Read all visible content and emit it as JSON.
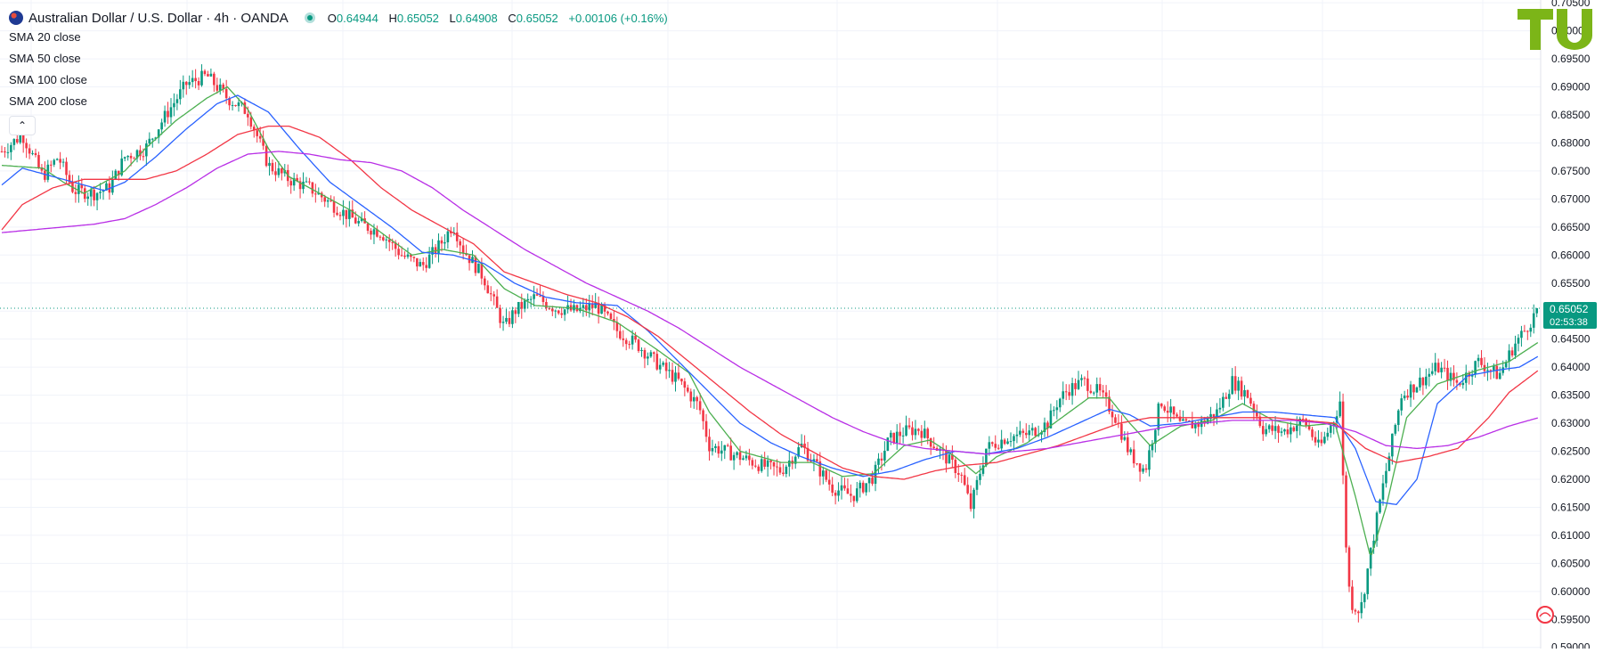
{
  "header": {
    "symbol_title": "Australian Dollar / U.S. Dollar · 4h · OANDA",
    "ohlc": {
      "open_label": "O",
      "open": "0.64944",
      "high_label": "H",
      "high": "0.65052",
      "low_label": "L",
      "low": "0.64908",
      "close_label": "C",
      "close": "0.65052",
      "change": "+0.00106 (+0.16%)"
    },
    "indicators": [
      {
        "name": "SMA",
        "param": "20 close"
      },
      {
        "name": "SMA",
        "param": "50 close"
      },
      {
        "name": "SMA",
        "param": "100 close"
      },
      {
        "name": "SMA",
        "param": "200 close"
      }
    ],
    "collapse_symbol": "⌃"
  },
  "price_badge": {
    "price": "0.65052",
    "countdown": "02:53:38"
  },
  "colors": {
    "up": "#089981",
    "down": "#f23645",
    "sma20": "#4caf50",
    "sma50": "#2962ff",
    "sma100": "#f23645",
    "sma200": "#b92fe6",
    "grid": "#f0f3fa",
    "axis_text": "#131722",
    "logo": "#7cb518"
  },
  "chart_data": {
    "type": "line",
    "title": "",
    "xlabel": "",
    "ylabel": "",
    "ylim": [
      0.5898,
      0.7055
    ],
    "y_ticks": [
      "0.59000",
      "0.59500",
      "0.60000",
      "0.60500",
      "0.61000",
      "0.61500",
      "0.62000",
      "0.62500",
      "0.63000",
      "0.63500",
      "0.64000",
      "0.64500",
      "0.65000",
      "0.65500",
      "0.66000",
      "0.66500",
      "0.67000",
      "0.67500",
      "0.68000",
      "0.68500",
      "0.69000",
      "0.69500",
      "0.70000",
      "0.70500"
    ],
    "grid": true,
    "last_price": 0.65052,
    "price_anchors": [
      [
        0,
        0.6785
      ],
      [
        20,
        0.6815
      ],
      [
        40,
        0.674
      ],
      [
        55,
        0.6775
      ],
      [
        70,
        0.6715
      ],
      [
        90,
        0.671
      ],
      [
        105,
        0.672
      ],
      [
        120,
        0.6775
      ],
      [
        140,
        0.679
      ],
      [
        160,
        0.685
      ],
      [
        180,
        0.6905
      ],
      [
        200,
        0.692
      ],
      [
        220,
        0.688
      ],
      [
        240,
        0.6855
      ],
      [
        260,
        0.676
      ],
      [
        280,
        0.6735
      ],
      [
        300,
        0.672
      ],
      [
        330,
        0.668
      ],
      [
        350,
        0.6655
      ],
      [
        370,
        0.664
      ],
      [
        390,
        0.66
      ],
      [
        410,
        0.658
      ],
      [
        430,
        0.6625
      ],
      [
        440,
        0.6655
      ],
      [
        450,
        0.661
      ],
      [
        470,
        0.656
      ],
      [
        490,
        0.647
      ],
      [
        500,
        0.65
      ],
      [
        520,
        0.6525
      ],
      [
        540,
        0.6505
      ],
      [
        560,
        0.65
      ],
      [
        580,
        0.651
      ],
      [
        600,
        0.6465
      ],
      [
        620,
        0.644
      ],
      [
        640,
        0.6405
      ],
      [
        660,
        0.6375
      ],
      [
        680,
        0.633
      ],
      [
        690,
        0.626
      ],
      [
        720,
        0.624
      ],
      [
        740,
        0.6225
      ],
      [
        760,
        0.6215
      ],
      [
        780,
        0.626
      ],
      [
        790,
        0.6235
      ],
      [
        810,
        0.6185
      ],
      [
        830,
        0.617
      ],
      [
        850,
        0.6205
      ],
      [
        865,
        0.627
      ],
      [
        880,
        0.6285
      ],
      [
        895,
        0.629
      ],
      [
        910,
        0.626
      ],
      [
        925,
        0.623
      ],
      [
        935,
        0.621
      ],
      [
        945,
        0.615
      ],
      [
        960,
        0.6255
      ],
      [
        980,
        0.6275
      ],
      [
        1000,
        0.628
      ],
      [
        1020,
        0.63
      ],
      [
        1030,
        0.634
      ],
      [
        1040,
        0.636
      ],
      [
        1055,
        0.6375
      ],
      [
        1070,
        0.6355
      ],
      [
        1085,
        0.6315
      ],
      [
        1100,
        0.6245
      ],
      [
        1115,
        0.6215
      ],
      [
        1130,
        0.634
      ],
      [
        1150,
        0.6295
      ],
      [
        1170,
        0.63
      ],
      [
        1185,
        0.632
      ],
      [
        1200,
        0.6375
      ],
      [
        1215,
        0.635
      ],
      [
        1230,
        0.629
      ],
      [
        1250,
        0.6285
      ],
      [
        1270,
        0.6305
      ],
      [
        1285,
        0.6255
      ],
      [
        1300,
        0.631
      ],
      [
        1305,
        0.634
      ],
      [
        1310,
        0.611
      ],
      [
        1315,
        0.598
      ],
      [
        1325,
        0.5965
      ],
      [
        1335,
        0.607
      ],
      [
        1345,
        0.617
      ],
      [
        1355,
        0.626
      ],
      [
        1365,
        0.635
      ],
      [
        1380,
        0.637
      ],
      [
        1400,
        0.64
      ],
      [
        1420,
        0.637
      ],
      [
        1440,
        0.641
      ],
      [
        1460,
        0.6385
      ],
      [
        1475,
        0.644
      ],
      [
        1485,
        0.6465
      ],
      [
        1499,
        0.6505
      ]
    ],
    "sma_anchors": {
      "SMA 20": [
        [
          0,
          0.676
        ],
        [
          40,
          0.6755
        ],
        [
          60,
          0.673
        ],
        [
          80,
          0.671
        ],
        [
          100,
          0.673
        ],
        [
          120,
          0.675
        ],
        [
          140,
          0.679
        ],
        [
          170,
          0.684
        ],
        [
          200,
          0.688
        ],
        [
          220,
          0.69
        ],
        [
          240,
          0.686
        ],
        [
          260,
          0.679
        ],
        [
          280,
          0.674
        ],
        [
          310,
          0.671
        ],
        [
          340,
          0.668
        ],
        [
          370,
          0.664
        ],
        [
          400,
          0.66
        ],
        [
          430,
          0.661
        ],
        [
          460,
          0.66
        ],
        [
          490,
          0.654
        ],
        [
          520,
          0.651
        ],
        [
          560,
          0.6505
        ],
        [
          600,
          0.648
        ],
        [
          640,
          0.643
        ],
        [
          670,
          0.639
        ],
        [
          690,
          0.632
        ],
        [
          720,
          0.625
        ],
        [
          760,
          0.623
        ],
        [
          790,
          0.623
        ],
        [
          820,
          0.6205
        ],
        [
          850,
          0.621
        ],
        [
          880,
          0.626
        ],
        [
          905,
          0.627
        ],
        [
          930,
          0.624
        ],
        [
          950,
          0.621
        ],
        [
          970,
          0.624
        ],
        [
          1000,
          0.6265
        ],
        [
          1030,
          0.6305
        ],
        [
          1060,
          0.6345
        ],
        [
          1080,
          0.6345
        ],
        [
          1100,
          0.63
        ],
        [
          1120,
          0.626
        ],
        [
          1150,
          0.6295
        ],
        [
          1180,
          0.6305
        ],
        [
          1210,
          0.6335
        ],
        [
          1240,
          0.6305
        ],
        [
          1270,
          0.6295
        ],
        [
          1300,
          0.63
        ],
        [
          1320,
          0.617
        ],
        [
          1335,
          0.606
        ],
        [
          1350,
          0.615
        ],
        [
          1370,
          0.631
        ],
        [
          1400,
          0.637
        ],
        [
          1440,
          0.6395
        ],
        [
          1470,
          0.641
        ],
        [
          1499,
          0.6445
        ]
      ],
      "SMA 50": [
        [
          0,
          0.6725
        ],
        [
          20,
          0.6755
        ],
        [
          40,
          0.6745
        ],
        [
          70,
          0.673
        ],
        [
          100,
          0.6715
        ],
        [
          120,
          0.673
        ],
        [
          150,
          0.6775
        ],
        [
          180,
          0.6825
        ],
        [
          210,
          0.687
        ],
        [
          230,
          0.6885
        ],
        [
          260,
          0.6855
        ],
        [
          290,
          0.679
        ],
        [
          320,
          0.673
        ],
        [
          350,
          0.669
        ],
        [
          380,
          0.665
        ],
        [
          410,
          0.6605
        ],
        [
          440,
          0.66
        ],
        [
          470,
          0.6585
        ],
        [
          500,
          0.655
        ],
        [
          530,
          0.6525
        ],
        [
          560,
          0.6515
        ],
        [
          600,
          0.651
        ],
        [
          630,
          0.6465
        ],
        [
          660,
          0.641
        ],
        [
          690,
          0.6355
        ],
        [
          720,
          0.63
        ],
        [
          750,
          0.6265
        ],
        [
          780,
          0.624
        ],
        [
          810,
          0.622
        ],
        [
          840,
          0.6205
        ],
        [
          870,
          0.6215
        ],
        [
          900,
          0.6235
        ],
        [
          930,
          0.625
        ],
        [
          960,
          0.6245
        ],
        [
          990,
          0.6255
        ],
        [
          1020,
          0.6275
        ],
        [
          1050,
          0.63
        ],
        [
          1080,
          0.6325
        ],
        [
          1100,
          0.6315
        ],
        [
          1120,
          0.6295
        ],
        [
          1150,
          0.63
        ],
        [
          1180,
          0.631
        ],
        [
          1210,
          0.632
        ],
        [
          1240,
          0.632
        ],
        [
          1270,
          0.6315
        ],
        [
          1300,
          0.631
        ],
        [
          1320,
          0.6255
        ],
        [
          1340,
          0.616
        ],
        [
          1360,
          0.6155
        ],
        [
          1380,
          0.62
        ],
        [
          1400,
          0.6335
        ],
        [
          1430,
          0.6385
        ],
        [
          1460,
          0.6395
        ],
        [
          1480,
          0.64
        ],
        [
          1499,
          0.642
        ]
      ],
      "SMA 100": [
        [
          0,
          0.6645
        ],
        [
          20,
          0.669
        ],
        [
          50,
          0.672
        ],
        [
          80,
          0.6735
        ],
        [
          110,
          0.6735
        ],
        [
          140,
          0.6735
        ],
        [
          170,
          0.675
        ],
        [
          200,
          0.678
        ],
        [
          230,
          0.6815
        ],
        [
          260,
          0.683
        ],
        [
          280,
          0.683
        ],
        [
          310,
          0.681
        ],
        [
          340,
          0.677
        ],
        [
          370,
          0.672
        ],
        [
          400,
          0.668
        ],
        [
          430,
          0.665
        ],
        [
          460,
          0.662
        ],
        [
          490,
          0.657
        ],
        [
          520,
          0.655
        ],
        [
          550,
          0.653
        ],
        [
          580,
          0.6515
        ],
        [
          610,
          0.649
        ],
        [
          640,
          0.6455
        ],
        [
          670,
          0.641
        ],
        [
          700,
          0.6365
        ],
        [
          730,
          0.632
        ],
        [
          760,
          0.628
        ],
        [
          790,
          0.625
        ],
        [
          820,
          0.622
        ],
        [
          850,
          0.6205
        ],
        [
          880,
          0.62
        ],
        [
          910,
          0.6215
        ],
        [
          940,
          0.6225
        ],
        [
          970,
          0.623
        ],
        [
          1000,
          0.6245
        ],
        [
          1030,
          0.626
        ],
        [
          1060,
          0.628
        ],
        [
          1090,
          0.63
        ],
        [
          1120,
          0.631
        ],
        [
          1150,
          0.631
        ],
        [
          1180,
          0.631
        ],
        [
          1210,
          0.631
        ],
        [
          1240,
          0.631
        ],
        [
          1270,
          0.6305
        ],
        [
          1300,
          0.63
        ],
        [
          1330,
          0.6255
        ],
        [
          1360,
          0.623
        ],
        [
          1390,
          0.624
        ],
        [
          1420,
          0.6255
        ],
        [
          1450,
          0.631
        ],
        [
          1470,
          0.6355
        ],
        [
          1499,
          0.6395
        ]
      ],
      "SMA 200": [
        [
          0,
          0.664
        ],
        [
          30,
          0.6645
        ],
        [
          60,
          0.665
        ],
        [
          90,
          0.6655
        ],
        [
          120,
          0.6665
        ],
        [
          150,
          0.669
        ],
        [
          180,
          0.672
        ],
        [
          210,
          0.6755
        ],
        [
          240,
          0.678
        ],
        [
          270,
          0.6785
        ],
        [
          300,
          0.678
        ],
        [
          330,
          0.677
        ],
        [
          360,
          0.6765
        ],
        [
          390,
          0.675
        ],
        [
          420,
          0.672
        ],
        [
          450,
          0.668
        ],
        [
          480,
          0.6645
        ],
        [
          510,
          0.661
        ],
        [
          540,
          0.658
        ],
        [
          570,
          0.655
        ],
        [
          600,
          0.6525
        ],
        [
          630,
          0.65
        ],
        [
          660,
          0.647
        ],
        [
          690,
          0.6435
        ],
        [
          720,
          0.64
        ],
        [
          750,
          0.637
        ],
        [
          780,
          0.634
        ],
        [
          810,
          0.631
        ],
        [
          840,
          0.6285
        ],
        [
          870,
          0.6265
        ],
        [
          900,
          0.6255
        ],
        [
          930,
          0.625
        ],
        [
          960,
          0.6245
        ],
        [
          990,
          0.625
        ],
        [
          1020,
          0.6255
        ],
        [
          1050,
          0.6265
        ],
        [
          1080,
          0.6275
        ],
        [
          1110,
          0.6285
        ],
        [
          1140,
          0.6295
        ],
        [
          1170,
          0.63
        ],
        [
          1200,
          0.6305
        ],
        [
          1230,
          0.6305
        ],
        [
          1260,
          0.6305
        ],
        [
          1290,
          0.63
        ],
        [
          1320,
          0.6285
        ],
        [
          1350,
          0.626
        ],
        [
          1380,
          0.6255
        ],
        [
          1410,
          0.626
        ],
        [
          1440,
          0.6275
        ],
        [
          1470,
          0.6295
        ],
        [
          1499,
          0.631
        ]
      ]
    },
    "series": [
      {
        "name": "SMA 20 close"
      },
      {
        "name": "SMA 50 close"
      },
      {
        "name": "SMA 100 close"
      },
      {
        "name": "SMA 200 close"
      }
    ]
  }
}
